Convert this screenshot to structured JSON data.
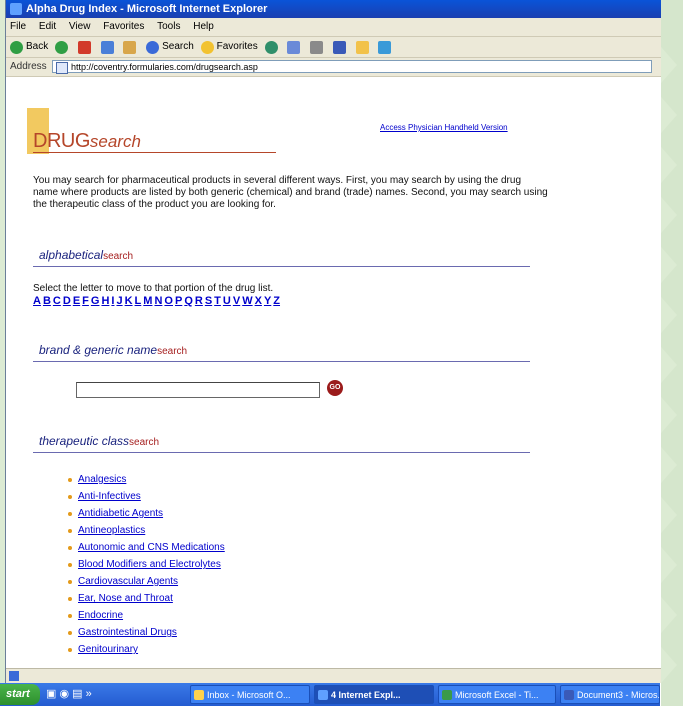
{
  "window": {
    "title": "Alpha Drug Index - Microsoft Internet Explorer"
  },
  "menu": [
    "File",
    "Edit",
    "View",
    "Favorites",
    "Tools",
    "Help"
  ],
  "toolbar": {
    "back": "Back",
    "search": "Search",
    "favorites": "Favorites"
  },
  "address": {
    "label": "Address",
    "url": "http://coventry.formularies.com/drugsearch.asp"
  },
  "page": {
    "logo_main": "DRUG",
    "logo_sub": "search",
    "handheld_link": "Access Physician Handheld Version",
    "intro": "You may search for pharmaceutical products in several different ways. First, you may search by using the drug name where products are listed by both generic (chemical) and brand (trade) names. Second, you may search using the therapeutic class of the product you are looking for.",
    "alpha_heading": "alphabetical",
    "alpha_heading_suffix": "search",
    "alpha_desc": "Select the letter to move to that portion of the drug list.",
    "letters": [
      "A",
      "B",
      "C",
      "D",
      "E",
      "F",
      "G",
      "H",
      "I",
      "J",
      "K",
      "L",
      "M",
      "N",
      "O",
      "P",
      "Q",
      "R",
      "S",
      "T",
      "U",
      "V",
      "W",
      "X",
      "Y",
      "Z"
    ],
    "brand_heading": "brand & generic name",
    "brand_heading_suffix": "search",
    "search_value": "",
    "go_label": "GO",
    "class_heading": "therapeutic class",
    "class_heading_suffix": "search",
    "classes": [
      "Analgesics",
      "Anti-Infectives",
      "Antidiabetic Agents",
      "Antineoplastics",
      "Autonomic and CNS Medications",
      "Blood Modifiers and Electrolytes",
      "Cardiovascular Agents",
      "Ear, Nose and Throat",
      "Endocrine",
      "Gastrointestinal Drugs",
      "Genitourinary"
    ]
  },
  "taskbar": {
    "start": "start",
    "tasks": [
      "Inbox - Microsoft O...",
      "4 Internet Expl...",
      "Microsoft Excel - Ti...",
      "Document3 - Micros..."
    ]
  }
}
